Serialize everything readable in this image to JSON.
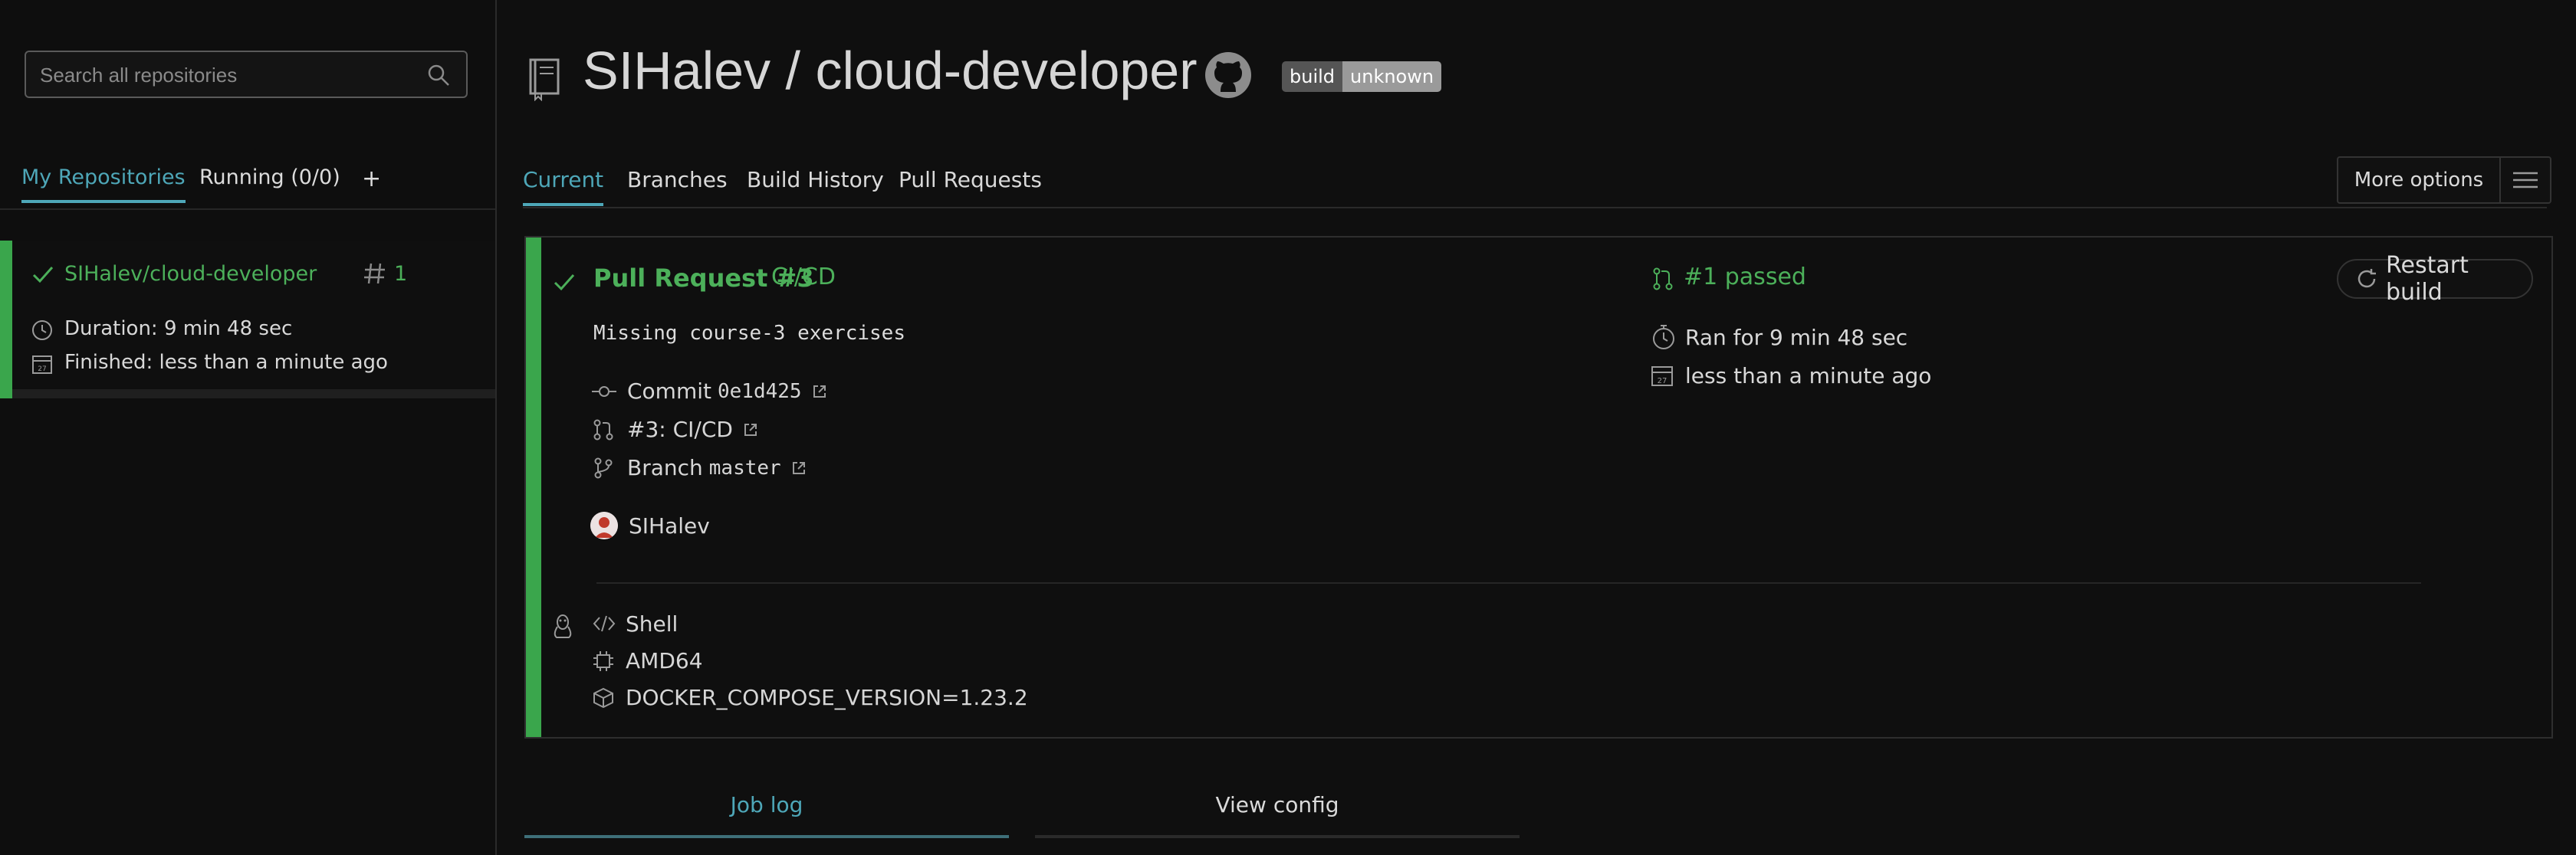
{
  "sidebar": {
    "search_placeholder": "Search all repositories",
    "tabs": [
      {
        "label": "My Repositories",
        "active": true
      },
      {
        "label": "Running (0/0)",
        "active": false
      },
      {
        "label": "+",
        "active": false
      }
    ],
    "repo": {
      "name": "SIHalev/cloud-developer",
      "build_number": "1",
      "duration": "Duration: 9 min 48 sec",
      "finished": "Finished: less than a minute ago",
      "status": "passed"
    }
  },
  "header": {
    "title": "SIHalev / cloud-developer",
    "badge": {
      "left": "build",
      "right": "unknown"
    }
  },
  "tabs": [
    {
      "label": "Current",
      "active": true
    },
    {
      "label": "Branches",
      "active": false
    },
    {
      "label": "Build History",
      "active": false
    },
    {
      "label": "Pull Requests",
      "active": false
    }
  ],
  "more_options_label": "More options",
  "build": {
    "pr_title": "Pull Request #3",
    "pr_type": "CI/CD",
    "commit_message": "Missing course-3 exercises",
    "commit_label": "Commit",
    "commit_sha": "0e1d425",
    "pr_ref": "#3: CI/CD",
    "branch_label": "Branch",
    "branch_name": "master",
    "author": "SIHalev",
    "status_text": "#1 passed",
    "ran_for": "Ran for 9 min 48 sec",
    "finished": "less than a minute ago",
    "restart_label": "Restart build",
    "language": "Shell",
    "arch": "AMD64",
    "env": "DOCKER_COMPOSE_VERSION=1.23.2"
  },
  "bottom_tabs": [
    {
      "label": "Job log",
      "active": true
    },
    {
      "label": "View config",
      "active": false
    }
  ],
  "colors": {
    "accent": "#4ea7b8",
    "success": "#3aa64c",
    "background": "#0f0f0f"
  }
}
